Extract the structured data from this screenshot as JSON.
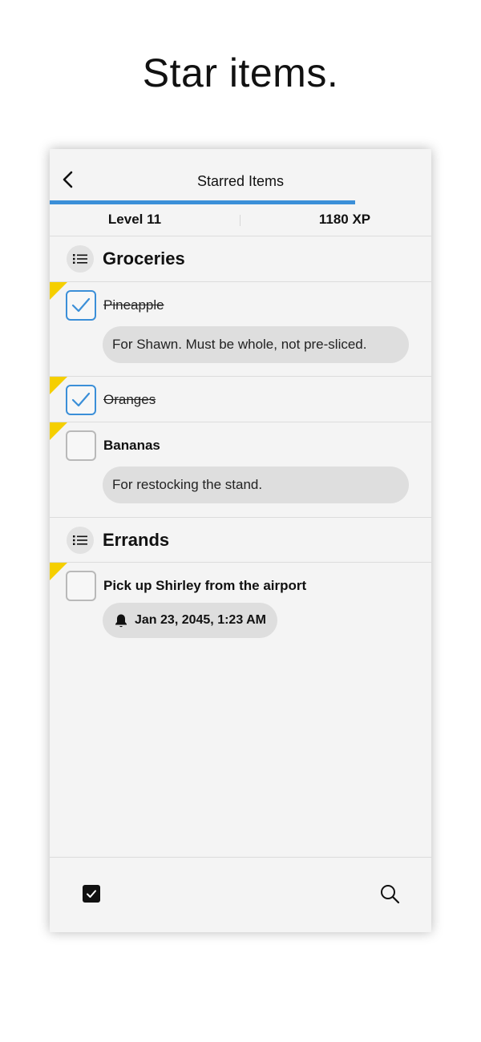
{
  "headline": "Star items.",
  "navbar": {
    "title": "Starred Items",
    "back_icon": "chevron-left-icon",
    "progress": 0.8
  },
  "stats": {
    "level": "Level 11",
    "xp": "1180 XP"
  },
  "lists": [
    {
      "title": "Groceries",
      "icon": "list-icon",
      "items": [
        {
          "title": "Pineapple",
          "checked": true,
          "starred": true,
          "note": "For Shawn. Must be whole, not pre-sliced."
        },
        {
          "title": "Oranges",
          "checked": true,
          "starred": true
        },
        {
          "title": "Bananas",
          "checked": false,
          "starred": true,
          "note": "For restocking the stand."
        }
      ]
    },
    {
      "title": "Errands",
      "icon": "list-icon",
      "items": [
        {
          "title": "Pick up Shirley from the airport",
          "checked": false,
          "starred": true,
          "reminder": "Jan 23, 2045, 1:23 AM",
          "reminder_icon": "bell-icon"
        }
      ]
    }
  ],
  "bottom_bar": {
    "left_icon": "checkbox-icon",
    "right_icon": "search-icon"
  },
  "colors": {
    "accent": "#3b8fd8",
    "star": "#f5cf00",
    "background": "#f4f4f4",
    "pill": "#dedede"
  }
}
